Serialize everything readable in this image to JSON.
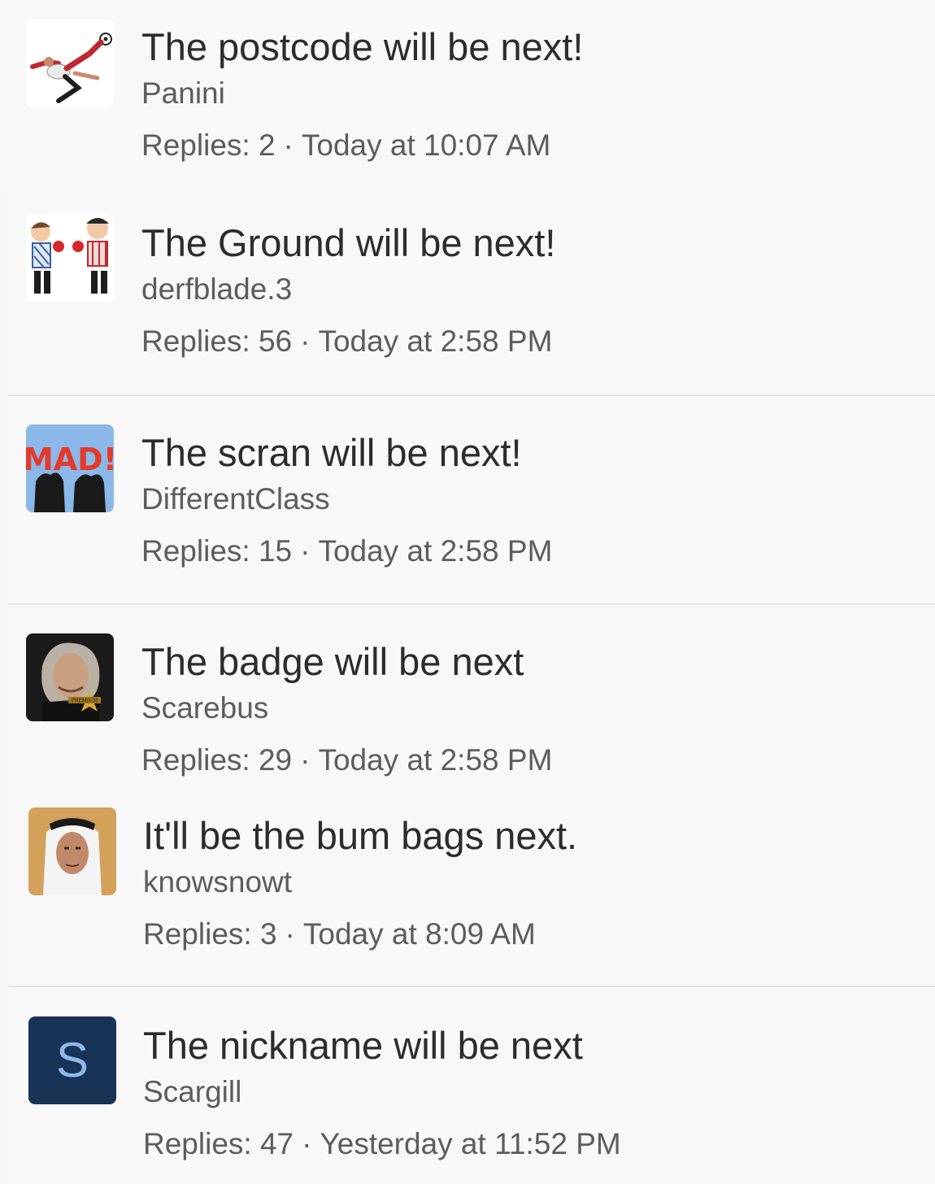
{
  "threads": [
    {
      "title": "The postcode will be next!",
      "author": "Panini",
      "replies_label": "Replies:",
      "replies": "2",
      "separator": "·",
      "time": "Today at 10:07 AM",
      "avatar_icon": "footballer-bicycle-kick-avatar"
    },
    {
      "title": "The Ground will be next!",
      "author": "derfblade.3",
      "replies_label": "Replies:",
      "replies": "56",
      "separator": "·",
      "time": "Today at 2:58 PM",
      "avatar_icon": "boxing-cartoon-avatar"
    },
    {
      "title": "The scran will be next!",
      "author": "DifferentClass",
      "replies_label": "Replies:",
      "replies": "15",
      "separator": "·",
      "time": "Today at 2:58 PM",
      "avatar_icon": "mad-silhouettes-avatar",
      "avatar_text": "MAD!"
    },
    {
      "title": "The badge will be next",
      "author": "Scarebus",
      "replies_label": "Replies:",
      "replies": "29",
      "separator": "·",
      "time": "Today at 2:58 PM",
      "avatar_icon": "portrait-premium-badge-avatar",
      "avatar_badge_text": "PREMIUM"
    },
    {
      "title": "It'll be the bum bags next.",
      "author": "knowsnowt",
      "replies_label": "Replies:",
      "replies": "3",
      "separator": "·",
      "time": "Today at 8:09 AM",
      "avatar_icon": "headdress-portrait-avatar"
    },
    {
      "title": "The nickname will be next",
      "author": "Scargill",
      "replies_label": "Replies:",
      "replies": "47",
      "separator": "·",
      "time": "Yesterday at 11:52 PM",
      "avatar_icon": "letter-avatar",
      "avatar_letter": "S"
    }
  ],
  "colors": {
    "background": "#f8f8f8",
    "title_text": "#2c2c2c",
    "secondary_text": "#5c5c5c",
    "divider": "#e3e3e3",
    "letter_avatar_bg": "#173456",
    "letter_avatar_fg": "#8fb8e6"
  }
}
